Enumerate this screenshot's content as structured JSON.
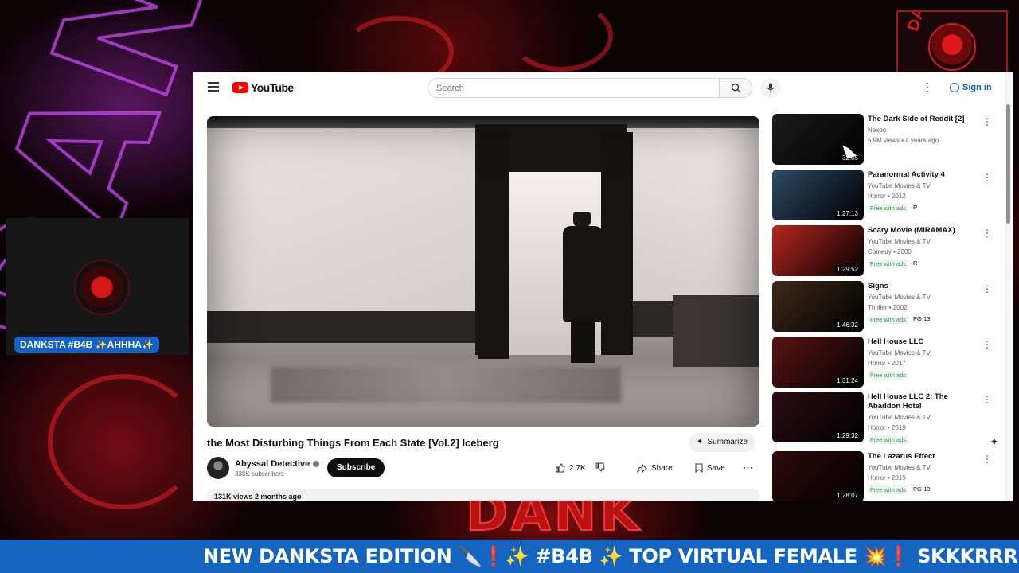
{
  "stream": {
    "bg_word": "DANK",
    "cam_name": "DANKSTA #B4B ✨AHHHA✨",
    "ticker": "NEW DANKSTA EDITION 🔪❗✨ #B4B ✨ TOP VIRTUAL FEMALE 💥❗ SKKKRRR 💨",
    "corner_logo_text": "DANK"
  },
  "youtube": {
    "logo": "YouTube",
    "search_placeholder": "Search",
    "signin": "Sign in",
    "video": {
      "title": "the Most Disturbing Things From Each State [Vol.2] Iceberg",
      "channel": "Abyssal Detective",
      "subscribers": "338K subscribers",
      "subscribe": "Subscribe",
      "likes": "2.7K",
      "share": "Share",
      "save": "Save",
      "summarize": "Summarize",
      "meta": "131K views  2 months ago"
    },
    "recommendations": [
      {
        "title": "The Dark Side of Reddit [2]",
        "line1": "Nexpo",
        "line2": "5.9M views • 4 years ago",
        "duration": "32:05",
        "free": "",
        "rating": "",
        "thumb": "#1c1c1c"
      },
      {
        "title": "Paranormal Activity 4",
        "line1": "YouTube Movies & TV",
        "line2": "Horror • 2012",
        "duration": "1:27:13",
        "free": "Free with ads",
        "rating": "R",
        "thumb": "#2e4a66"
      },
      {
        "title": "Scary Movie (MIRAMAX)",
        "line1": "YouTube Movies & TV",
        "line2": "Comedy • 2000",
        "duration": "1:29:52",
        "free": "Free with ads",
        "rating": "R",
        "thumb": "#b8261e"
      },
      {
        "title": "Signs",
        "line1": "YouTube Movies & TV",
        "line2": "Thriller • 2002",
        "duration": "1:46:32",
        "free": "Free with ads",
        "rating": "PG-13",
        "thumb": "#3d2a1a"
      },
      {
        "title": "Hell House LLC",
        "line1": "YouTube Movies & TV",
        "line2": "Horror • 2017",
        "duration": "1:31:24",
        "free": "Free with ads",
        "rating": "",
        "thumb": "#5a1414"
      },
      {
        "title": "Hell House LLC 2: The Abaddon Hotel",
        "line1": "YouTube Movies & TV",
        "line2": "Horror • 2019",
        "duration": "1:29:32",
        "free": "Free with ads",
        "rating": "",
        "thumb": "#2a0e14"
      },
      {
        "title": "The Lazarus Effect",
        "line1": "YouTube Movies & TV",
        "line2": "Horror • 2015",
        "duration": "1:28:07",
        "free": "Free with ads",
        "rating": "PG-13",
        "thumb": "#300a0a"
      }
    ]
  }
}
